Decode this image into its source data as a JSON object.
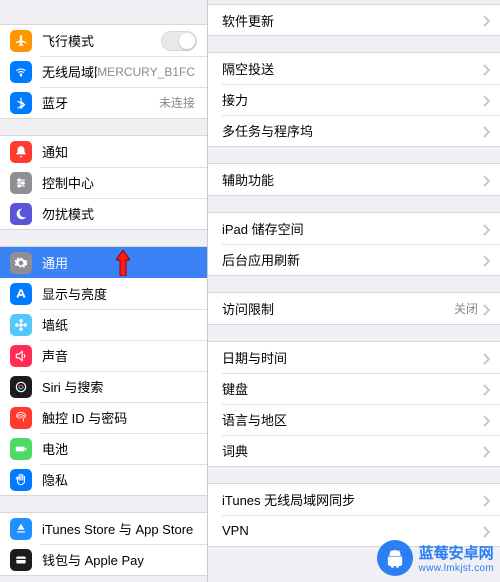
{
  "sidebar": {
    "group1": [
      {
        "name": "airplane-mode",
        "label": "飞行模式",
        "icon": "airplane",
        "bg": "#ff9500",
        "control": "toggle"
      },
      {
        "name": "wifi",
        "label": "无线局域网",
        "icon": "wifi",
        "bg": "#007aff",
        "detail": "MERCURY_B1FC"
      },
      {
        "name": "bluetooth",
        "label": "蓝牙",
        "icon": "bluetooth",
        "bg": "#007aff",
        "detail": "未连接"
      }
    ],
    "group2": [
      {
        "name": "notifications",
        "label": "通知",
        "icon": "bell",
        "bg": "#ff3b30"
      },
      {
        "name": "control-center",
        "label": "控制中心",
        "icon": "sliders",
        "bg": "#8e8e93"
      },
      {
        "name": "do-not-disturb",
        "label": "勿扰模式",
        "icon": "moon",
        "bg": "#5856d6"
      }
    ],
    "group3": [
      {
        "name": "general",
        "label": "通用",
        "icon": "gear",
        "bg": "#8e8e93",
        "selected": true,
        "callout": true
      },
      {
        "name": "display",
        "label": "显示与亮度",
        "icon": "textsize",
        "bg": "#007aff"
      },
      {
        "name": "wallpaper",
        "label": "墙纸",
        "icon": "flower",
        "bg": "#54c7fc"
      },
      {
        "name": "sounds",
        "label": "声音",
        "icon": "speaker",
        "bg": "#ff2d55"
      },
      {
        "name": "siri",
        "label": "Siri 与搜索",
        "icon": "siri",
        "bg": "#1c1c1e"
      },
      {
        "name": "touchid",
        "label": "触控 ID 与密码",
        "icon": "finger",
        "bg": "#ff3b30"
      },
      {
        "name": "battery",
        "label": "电池",
        "icon": "battery",
        "bg": "#4cd964"
      },
      {
        "name": "privacy",
        "label": "隐私",
        "icon": "hand",
        "bg": "#007aff"
      }
    ],
    "group4": [
      {
        "name": "itunes-appstore",
        "label": "iTunes Store 与 App Store",
        "icon": "appstore",
        "bg": "#1e90ff"
      },
      {
        "name": "wallet",
        "label": "钱包与 Apple Pay",
        "icon": "wallet",
        "bg": "#1c1c1e"
      }
    ]
  },
  "main": {
    "g1": [
      {
        "name": "software-update",
        "label": "软件更新"
      }
    ],
    "g2": [
      {
        "name": "airdrop",
        "label": "隔空投送"
      },
      {
        "name": "handoff",
        "label": "接力"
      },
      {
        "name": "multitasking",
        "label": "多任务与程序坞"
      }
    ],
    "g3": [
      {
        "name": "accessibility",
        "label": "辅助功能"
      }
    ],
    "g4": [
      {
        "name": "ipad-storage",
        "label": "iPad 储存空间"
      },
      {
        "name": "background-refresh",
        "label": "后台应用刷新"
      }
    ],
    "g5": [
      {
        "name": "restrictions",
        "label": "访问限制",
        "detail": "关闭"
      }
    ],
    "g6": [
      {
        "name": "date-time",
        "label": "日期与时间"
      },
      {
        "name": "keyboard",
        "label": "键盘"
      },
      {
        "name": "language-region",
        "label": "语言与地区"
      },
      {
        "name": "dictionary",
        "label": "词典"
      }
    ],
    "g7": [
      {
        "name": "itunes-wifi-sync",
        "label": "iTunes 无线局域网同步"
      },
      {
        "name": "vpn",
        "label": "VPN"
      }
    ]
  },
  "watermark": {
    "title": "蓝莓安卓网",
    "url": "www.lmkjst.com"
  }
}
